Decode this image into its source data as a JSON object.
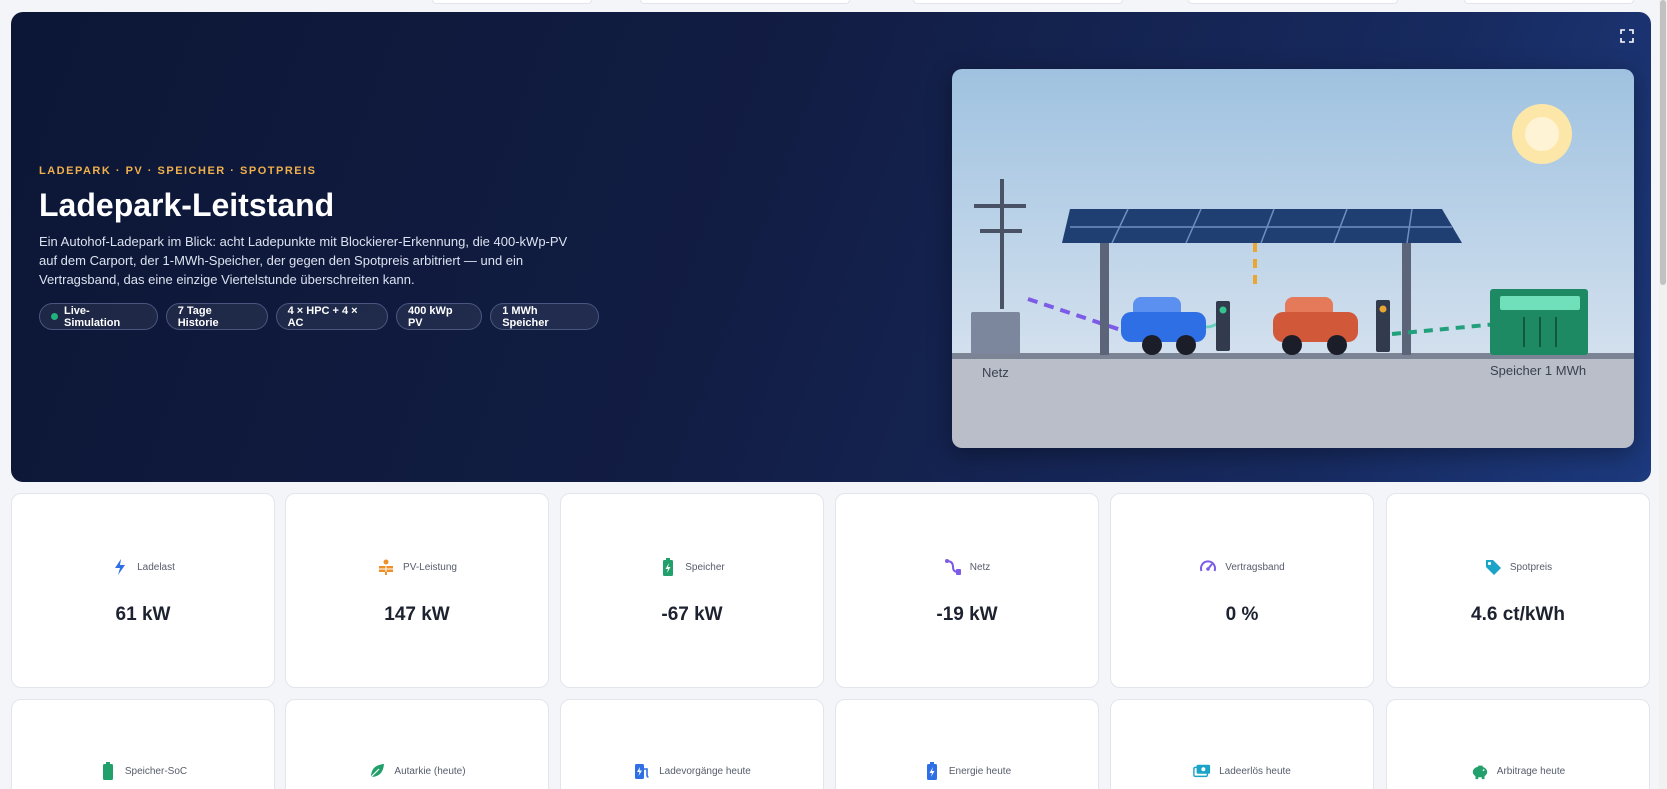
{
  "hero": {
    "eyebrow": "LADEPARK · PV · SPEICHER · SPOTPREIS",
    "title": "Ladepark-Leitstand",
    "description": "Ein Autohof-Ladepark im Blick: acht Ladepunkte mit Blockierer-Erkennung, die 400-kWp-PV auf dem Carport, der 1-MWh-Speicher, der gegen den Spotpreis arbitriert — und ein Vertragsband, das eine einzige Viertelstunde überschreiten kann.",
    "chips": [
      {
        "label": "Live-Simulation",
        "status_color": "#22b07d"
      },
      {
        "label": "7 Tage Historie"
      },
      {
        "label": "4 × HPC + 4 × AC"
      },
      {
        "label": "400 kWp PV"
      },
      {
        "label": "1 MWh Speicher"
      }
    ],
    "fullscreen_icon": "fullscreen-icon"
  },
  "scene": {
    "grid_label": "Netz",
    "storage_label": "Speicher 1 MWh",
    "colors": {
      "sky": "#a9c8e3",
      "ground": "#b9bec8",
      "car_1": "#2f6fe6",
      "car_2": "#d2583a",
      "storage": "#1e8a64",
      "sun": "#fde7a8"
    }
  },
  "kpis": [
    {
      "label": "Ladelast",
      "value": "61 kW",
      "icon": "bolt-icon",
      "color": "#2f6fe6"
    },
    {
      "label": "PV-Leistung",
      "value": "147 kW",
      "icon": "solar-panel-icon",
      "color": "#ef8f2a"
    },
    {
      "label": "Speicher",
      "value": "-67 kW",
      "icon": "battery-charging-icon",
      "color": "#22a06b"
    },
    {
      "label": "Netz",
      "value": "-19 kW",
      "icon": "plug-icon",
      "color": "#7c5ce6"
    },
    {
      "label": "Vertragsband",
      "value": "0 %",
      "icon": "gauge-icon",
      "color": "#7c5ce6"
    },
    {
      "label": "Spotpreis",
      "value": "4.6 ct/kWh",
      "icon": "price-tag-icon",
      "color": "#1ba4c8"
    }
  ],
  "kpis_row2": [
    {
      "label": "Speicher-SoC",
      "icon": "battery-full-icon",
      "color": "#22a06b"
    },
    {
      "label": "Autarkie (heute)",
      "icon": "leaf-icon",
      "color": "#22a06b"
    },
    {
      "label": "Ladevorgänge heute",
      "icon": "ev-station-icon",
      "color": "#2f6fe6"
    },
    {
      "label": "Energie heute",
      "icon": "battery-bolt-icon",
      "color": "#2f6fe6"
    },
    {
      "label": "Ladeerlös heute",
      "icon": "money-icon",
      "color": "#1ba4c8"
    },
    {
      "label": "Arbitrage heute",
      "icon": "piggy-bank-icon",
      "color": "#22a06b"
    }
  ]
}
